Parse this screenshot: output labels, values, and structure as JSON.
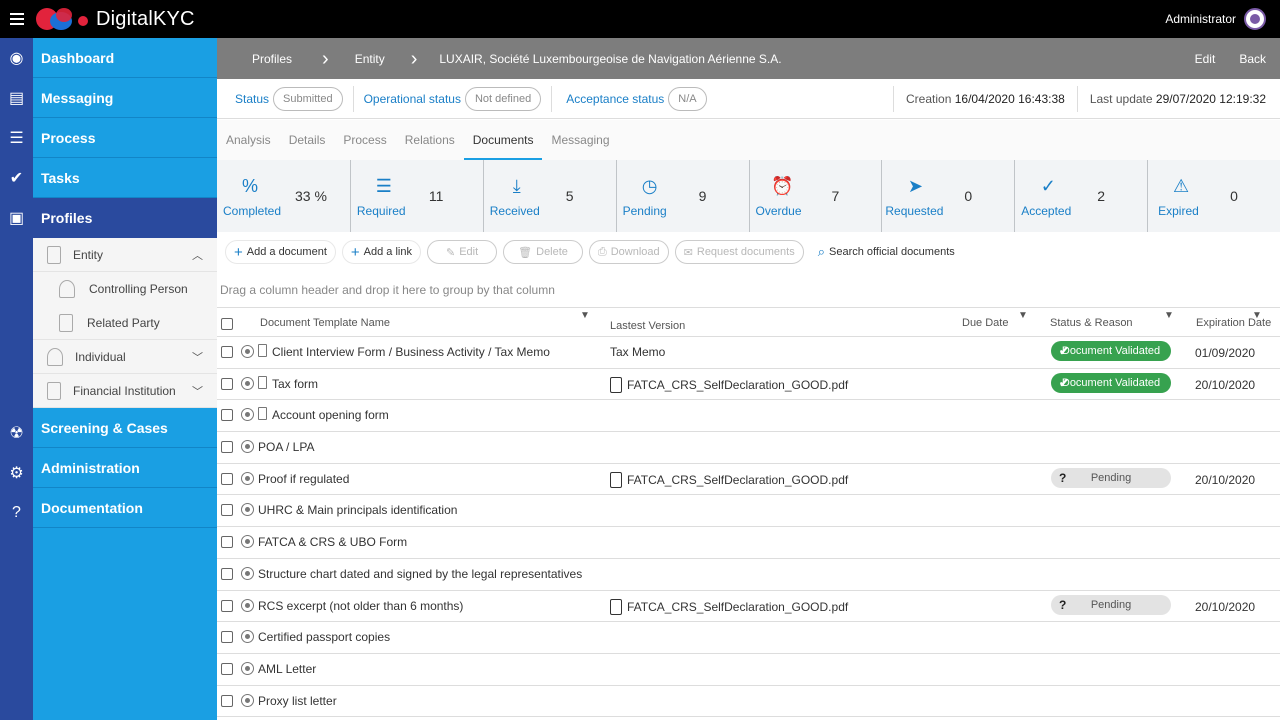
{
  "app": {
    "name": "DigitalKYC",
    "user": "Administrator"
  },
  "nav": {
    "items": [
      {
        "label": "Dashboard",
        "icon": "dashboard-icon"
      },
      {
        "label": "Messaging",
        "icon": "messaging-icon"
      },
      {
        "label": "Process",
        "icon": "process-icon"
      },
      {
        "label": "Tasks",
        "icon": "tasks-icon"
      },
      {
        "label": "Profiles",
        "icon": "profiles-icon"
      }
    ],
    "profiles_sub": {
      "entity": "Entity",
      "controlling_person": "Controlling Person",
      "related_party": "Related Party",
      "individual": "Individual",
      "financial_institution": "Financial Institution"
    },
    "bottom_items": [
      {
        "label": "Screening & Cases",
        "icon": "screening-icon"
      },
      {
        "label": "Administration",
        "icon": "gears-icon"
      },
      {
        "label": "Documentation",
        "icon": "help-icon"
      }
    ]
  },
  "breadcrumb": {
    "items": [
      "Profiles",
      "Entity",
      "LUXAIR, Société Luxembourgeoise de Navigation Aérienne S.A."
    ],
    "edit": "Edit",
    "back": "Back"
  },
  "status": {
    "status_label": "Status",
    "status_value": "Submitted",
    "operational_label": "Operational status",
    "operational_value": "Not defined",
    "acceptance_label": "Acceptance status",
    "acceptance_value": "N/A",
    "creation_label": "Creation",
    "creation_value": "16/04/2020 16:43:38",
    "update_label": "Last update",
    "update_value": "29/07/2020 12:19:32"
  },
  "tabs": [
    "Analysis",
    "Details",
    "Process",
    "Relations",
    "Documents",
    "Messaging"
  ],
  "active_tab": "Documents",
  "counters": [
    {
      "label": "Completed",
      "value": "33 %",
      "icon": "percent-icon",
      "glyph": "%"
    },
    {
      "label": "Required",
      "value": "11",
      "icon": "checklist-icon",
      "glyph": "☰"
    },
    {
      "label": "Received",
      "value": "5",
      "icon": "download-icon",
      "glyph": "⤓"
    },
    {
      "label": "Pending",
      "value": "9",
      "icon": "clock-arrow-icon",
      "glyph": "◷"
    },
    {
      "label": "Overdue",
      "value": "7",
      "icon": "alarm-icon",
      "glyph": "⏰"
    },
    {
      "label": "Requested",
      "value": "0",
      "icon": "paper-plane-icon",
      "glyph": "➤"
    },
    {
      "label": "Accepted",
      "value": "2",
      "icon": "check-circle-icon",
      "glyph": "✓"
    },
    {
      "label": "Expired",
      "value": "0",
      "icon": "warning-triangle-icon",
      "glyph": "⚠"
    }
  ],
  "toolbar": {
    "add_document": "Add a document",
    "add_link": "Add a link",
    "edit": "Edit",
    "delete": "Delete",
    "download": "Download",
    "request": "Request documents",
    "search": "Search official documents"
  },
  "group_hint": "Drag a column header and drop it here to group by that column",
  "grid": {
    "headers": {
      "name": "Document Template Name",
      "version": "Lastest Version",
      "due": "Due Date",
      "status": "Status & Reason",
      "expiration": "Expiration Date"
    },
    "rows": [
      {
        "name": "Client Interview Form / Business Activity / Tax Memo",
        "version": "Tax Memo",
        "has_pdf": false,
        "has_doc": true,
        "status": "Document Validated",
        "status_type": "ok",
        "expiration": "01/09/2020"
      },
      {
        "name": "Tax form",
        "version": "FATCA_CRS_SelfDeclaration_GOOD.pdf",
        "has_pdf": true,
        "has_doc": true,
        "status": "Document Validated",
        "status_type": "ok",
        "expiration": "20/10/2020"
      },
      {
        "name": "Account opening form",
        "version": "",
        "has_pdf": false,
        "has_doc": true,
        "status": "",
        "status_type": "",
        "expiration": ""
      },
      {
        "name": "POA / LPA",
        "version": "",
        "has_pdf": false,
        "has_doc": false,
        "status": "",
        "status_type": "",
        "expiration": ""
      },
      {
        "name": "Proof if regulated",
        "version": "FATCA_CRS_SelfDeclaration_GOOD.pdf",
        "has_pdf": true,
        "has_doc": false,
        "status": "Pending",
        "status_type": "pend",
        "expiration": "20/10/2020"
      },
      {
        "name": "UHRC & Main principals identification",
        "version": "",
        "has_pdf": false,
        "has_doc": false,
        "status": "",
        "status_type": "",
        "expiration": ""
      },
      {
        "name": "FATCA & CRS & UBO Form",
        "version": "",
        "has_pdf": false,
        "has_doc": false,
        "status": "",
        "status_type": "",
        "expiration": ""
      },
      {
        "name": "Structure chart dated and signed by the legal representatives",
        "version": "",
        "has_pdf": false,
        "has_doc": false,
        "status": "",
        "status_type": "",
        "expiration": ""
      },
      {
        "name": "RCS excerpt (not older than 6 months)",
        "version": "FATCA_CRS_SelfDeclaration_GOOD.pdf",
        "has_pdf": true,
        "has_doc": false,
        "status": "Pending",
        "status_type": "pend",
        "expiration": "20/10/2020"
      },
      {
        "name": "Certified passport copies",
        "version": "",
        "has_pdf": false,
        "has_doc": false,
        "status": "",
        "status_type": "",
        "expiration": ""
      },
      {
        "name": "AML Letter",
        "version": "",
        "has_pdf": false,
        "has_doc": false,
        "status": "",
        "status_type": "",
        "expiration": ""
      },
      {
        "name": "Proxy list letter",
        "version": "",
        "has_pdf": false,
        "has_doc": false,
        "status": "",
        "status_type": "",
        "expiration": ""
      }
    ]
  },
  "colors": {
    "nav_blue": "#1a9fe3",
    "nav_active": "#2a4a9e",
    "accent": "#1a7fc7",
    "ok_green": "#37a24f"
  }
}
